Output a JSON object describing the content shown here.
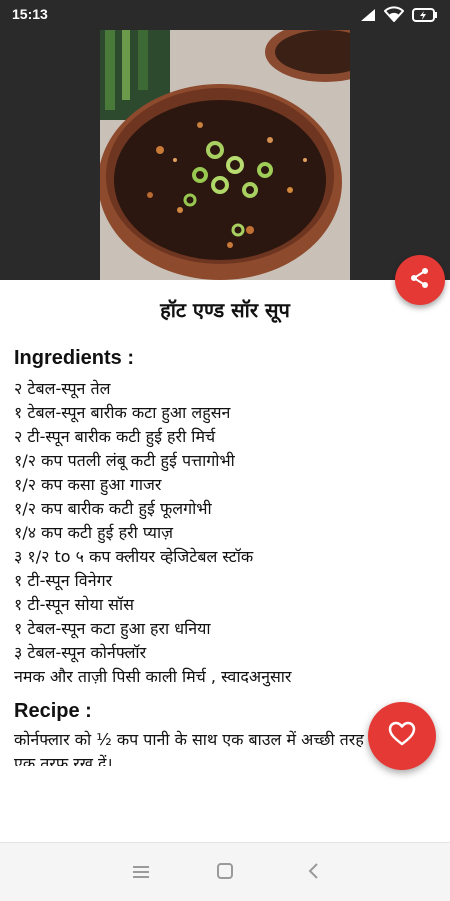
{
  "status_bar": {
    "time": "15:13",
    "icons": [
      "signal-icon",
      "wifi-icon",
      "battery-charging-icon"
    ]
  },
  "recipe": {
    "title": "हॉट एण्ड सॉर सूप",
    "ingredients_heading": "Ingredients :",
    "ingredients": [
      " २ टेबल-स्पून तेल",
      "१ टेबल-स्पून बारीक कटा हुआ लहुसन",
      "२ टी-स्पून बारीक कटी हुई हरी मिर्च",
      "१/२ कप पतली लंबू कटी हुई पत्तागोभी",
      "१/२ कप कसा हुआ गाजर",
      "१/२ कप बारीक कटी हुई फूलगोभी",
      "१/४ कप कटी हुई हरी प्याज़",
      "३ १/२ to ५ कप क्लीयर व्हेजिटेबल स्टॉक",
      "१ टी-स्पून विनेगर",
      "१ टी-स्पून सोया सॉस",
      "१ टेबल-स्पून कटा हुआ हरा धनिया",
      "३ टेबल-स्पून कोर्नफ्लॉर",
      "नमक और ताज़ी पिसी काली मिर्च , स्वादअनुसार"
    ],
    "recipe_heading": "Recipe :",
    "recipe_text": "कोर्नफ्लार को ½ कप पानी के साथ एक बाउल में अच्छी तरह मिला लें। एक तरफ रख दें।"
  },
  "actions": {
    "share_icon": "share-icon",
    "favorite_icon": "heart-outline-icon"
  },
  "nav": {
    "icons": [
      "menu-icon",
      "home-square-icon",
      "back-chevron-icon"
    ]
  },
  "colors": {
    "accent": "#e53935",
    "status_bar": "#2a2a2a",
    "nav_bar": "#f5f5f5"
  }
}
